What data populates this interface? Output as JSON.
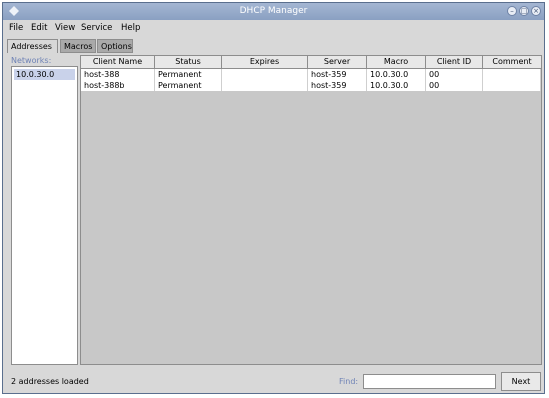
{
  "window": {
    "title": "DHCP Manager"
  },
  "menubar": [
    "File",
    "Edit",
    "View",
    "Service",
    "Help"
  ],
  "tabs": [
    {
      "label": "Addresses",
      "active": true
    },
    {
      "label": "Macros",
      "active": false
    },
    {
      "label": "Options",
      "active": false
    }
  ],
  "network_panel": {
    "label": "Networks:",
    "items": [
      "10.0.30.0"
    ]
  },
  "table": {
    "columns": [
      "Client Name",
      "Status",
      "Expires",
      "Server",
      "Macro",
      "Client ID",
      "Comment"
    ],
    "rows": [
      [
        "host-388",
        "Permanent",
        "",
        "host-359",
        "10.0.30.0",
        "00",
        ""
      ],
      [
        "host-388b",
        "Permanent",
        "",
        "host-359",
        "10.0.30.0",
        "00",
        ""
      ]
    ]
  },
  "statusbar": {
    "message": "2 addresses loaded",
    "find_label": "Find:",
    "find_value": "",
    "next_label": "Next"
  },
  "colors": {
    "title_gradient_top": "#a4b6d3",
    "title_gradient_bottom": "#8aa0c2",
    "accent_text": "#6f83b6",
    "selection": "#c9d2ea"
  },
  "icons": [
    "window-menu-icon",
    "minimize-icon",
    "maximize-icon",
    "close-icon"
  ]
}
